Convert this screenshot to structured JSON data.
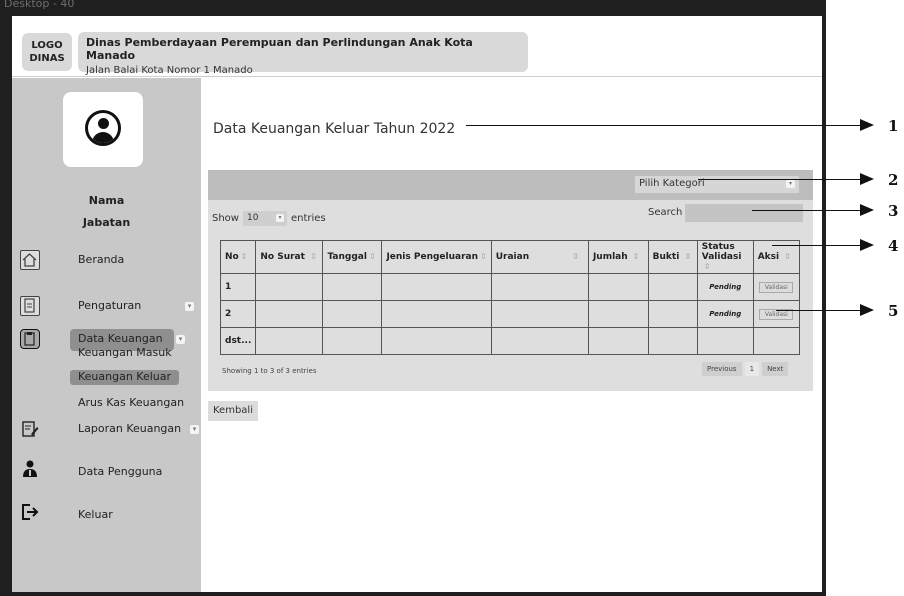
{
  "frame": {
    "title": "Desktop - 40"
  },
  "header": {
    "logo_line1": "LOGO",
    "logo_line2": "DINAS",
    "org_name": "Dinas Pemberdayaan Perempuan dan Perlindungan Anak Kota Manado",
    "org_address": "Jalan Balai Kota Nomor 1 Manado"
  },
  "sidebar": {
    "user_name": "Nama",
    "user_role": "Jabatan",
    "menu": [
      {
        "label": "Beranda",
        "icon": "home-icon"
      },
      {
        "label": "Pengaturan",
        "icon": "document-icon"
      },
      {
        "label": "Data Keuangan",
        "icon": "clipboard-icon"
      },
      {
        "label": "Laporan Keuangan",
        "icon": "edit-report-icon"
      },
      {
        "label": "Data Pengguna",
        "icon": "person-icon"
      },
      {
        "label": "Keluar",
        "icon": "logout-icon"
      }
    ],
    "submenu": [
      "Keuangan Masuk",
      "Keuangan Keluar",
      "Arus Kas Keuangan"
    ]
  },
  "main": {
    "title": "Data Keuangan Keluar Tahun 2022",
    "category_placeholder": "Pilih Kategori",
    "show_label": "Show",
    "entries_value": "10",
    "entries_label": "entries",
    "search_label": "Search",
    "columns": [
      "No",
      "No Surat",
      "Tanggal",
      "Jenis Pengeluaran",
      "Uraian",
      "Jumlah",
      "Bukti",
      "Status Validasi",
      "Aksi"
    ],
    "rows": [
      {
        "no": "1",
        "status": "Pending",
        "action": "Validasi"
      },
      {
        "no": "2",
        "status": "Pending",
        "action": "Validasi"
      },
      {
        "no": "dst...",
        "status": "",
        "action": ""
      }
    ],
    "showing_text": "Showing 1 to 3 of 3 entries",
    "pager": {
      "prev": "Previous",
      "page": "1",
      "next": "Next"
    },
    "back_button": "Kembali"
  },
  "annotations": [
    "1",
    "2",
    "3",
    "4",
    "5"
  ]
}
